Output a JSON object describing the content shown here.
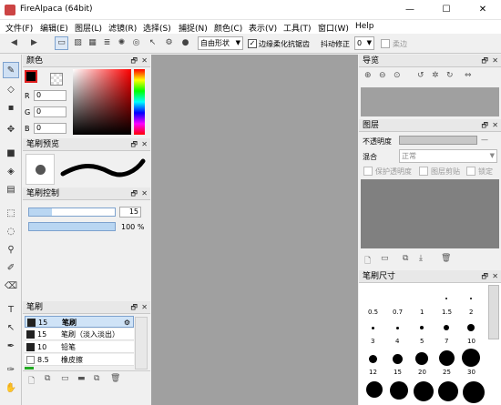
{
  "window": {
    "title": "FireAlpaca (64bit)",
    "minimize": "—",
    "maximize": "☐",
    "close": "✕"
  },
  "menu": [
    "文件(F)",
    "编辑(E)",
    "图层(L)",
    "滤镜(R)",
    "选择(S)",
    "捕捉(N)",
    "颜色(C)",
    "表示(V)",
    "工具(T)",
    "窗口(W)",
    "Help"
  ],
  "toolbar": {
    "mode": "自由形状",
    "edge_label": "边缘柔化抗锯齿",
    "tremor_label": "抖动修正",
    "tremor_value": "0",
    "snap_label": "柔边"
  },
  "color_panel": {
    "title": "颜色",
    "r_label": "R",
    "g_label": "G",
    "b_label": "B",
    "r": "0",
    "g": "0",
    "b": "0",
    "primary": "#000000",
    "accent": "#e02020"
  },
  "brush_preview": {
    "title": "笔刷预览"
  },
  "brush_control": {
    "title": "笔刷控制",
    "size": "15",
    "opacity": "100 %",
    "size_fill": 0.27,
    "opacity_fill": 1.0
  },
  "brush_panel": {
    "title": "笔刷",
    "items": [
      {
        "size": "15",
        "name": "笔刷",
        "selected": true
      },
      {
        "size": "15",
        "name": "笔刷（淡入淡出）",
        "selected": false
      },
      {
        "size": "10",
        "name": "铅笔",
        "selected": false
      },
      {
        "size": "8.5",
        "name": "橡皮擦",
        "selected": false
      }
    ]
  },
  "navigator": {
    "title": "导览"
  },
  "layer_panel": {
    "title": "图层",
    "opacity_label": "不透明度",
    "opacity_value": "—",
    "blend_label": "混合",
    "blend_value": "正常",
    "protect_label": "保护透明度",
    "clip_label": "图层剪贴",
    "lock_label": "锁定"
  },
  "brush_size": {
    "title": "笔刷尺寸",
    "labels": [
      "0.5",
      "0.7",
      "1",
      "1.5",
      "2",
      "3",
      "4",
      "5",
      "7",
      "10",
      "12",
      "15",
      "20",
      "25",
      "30"
    ]
  }
}
